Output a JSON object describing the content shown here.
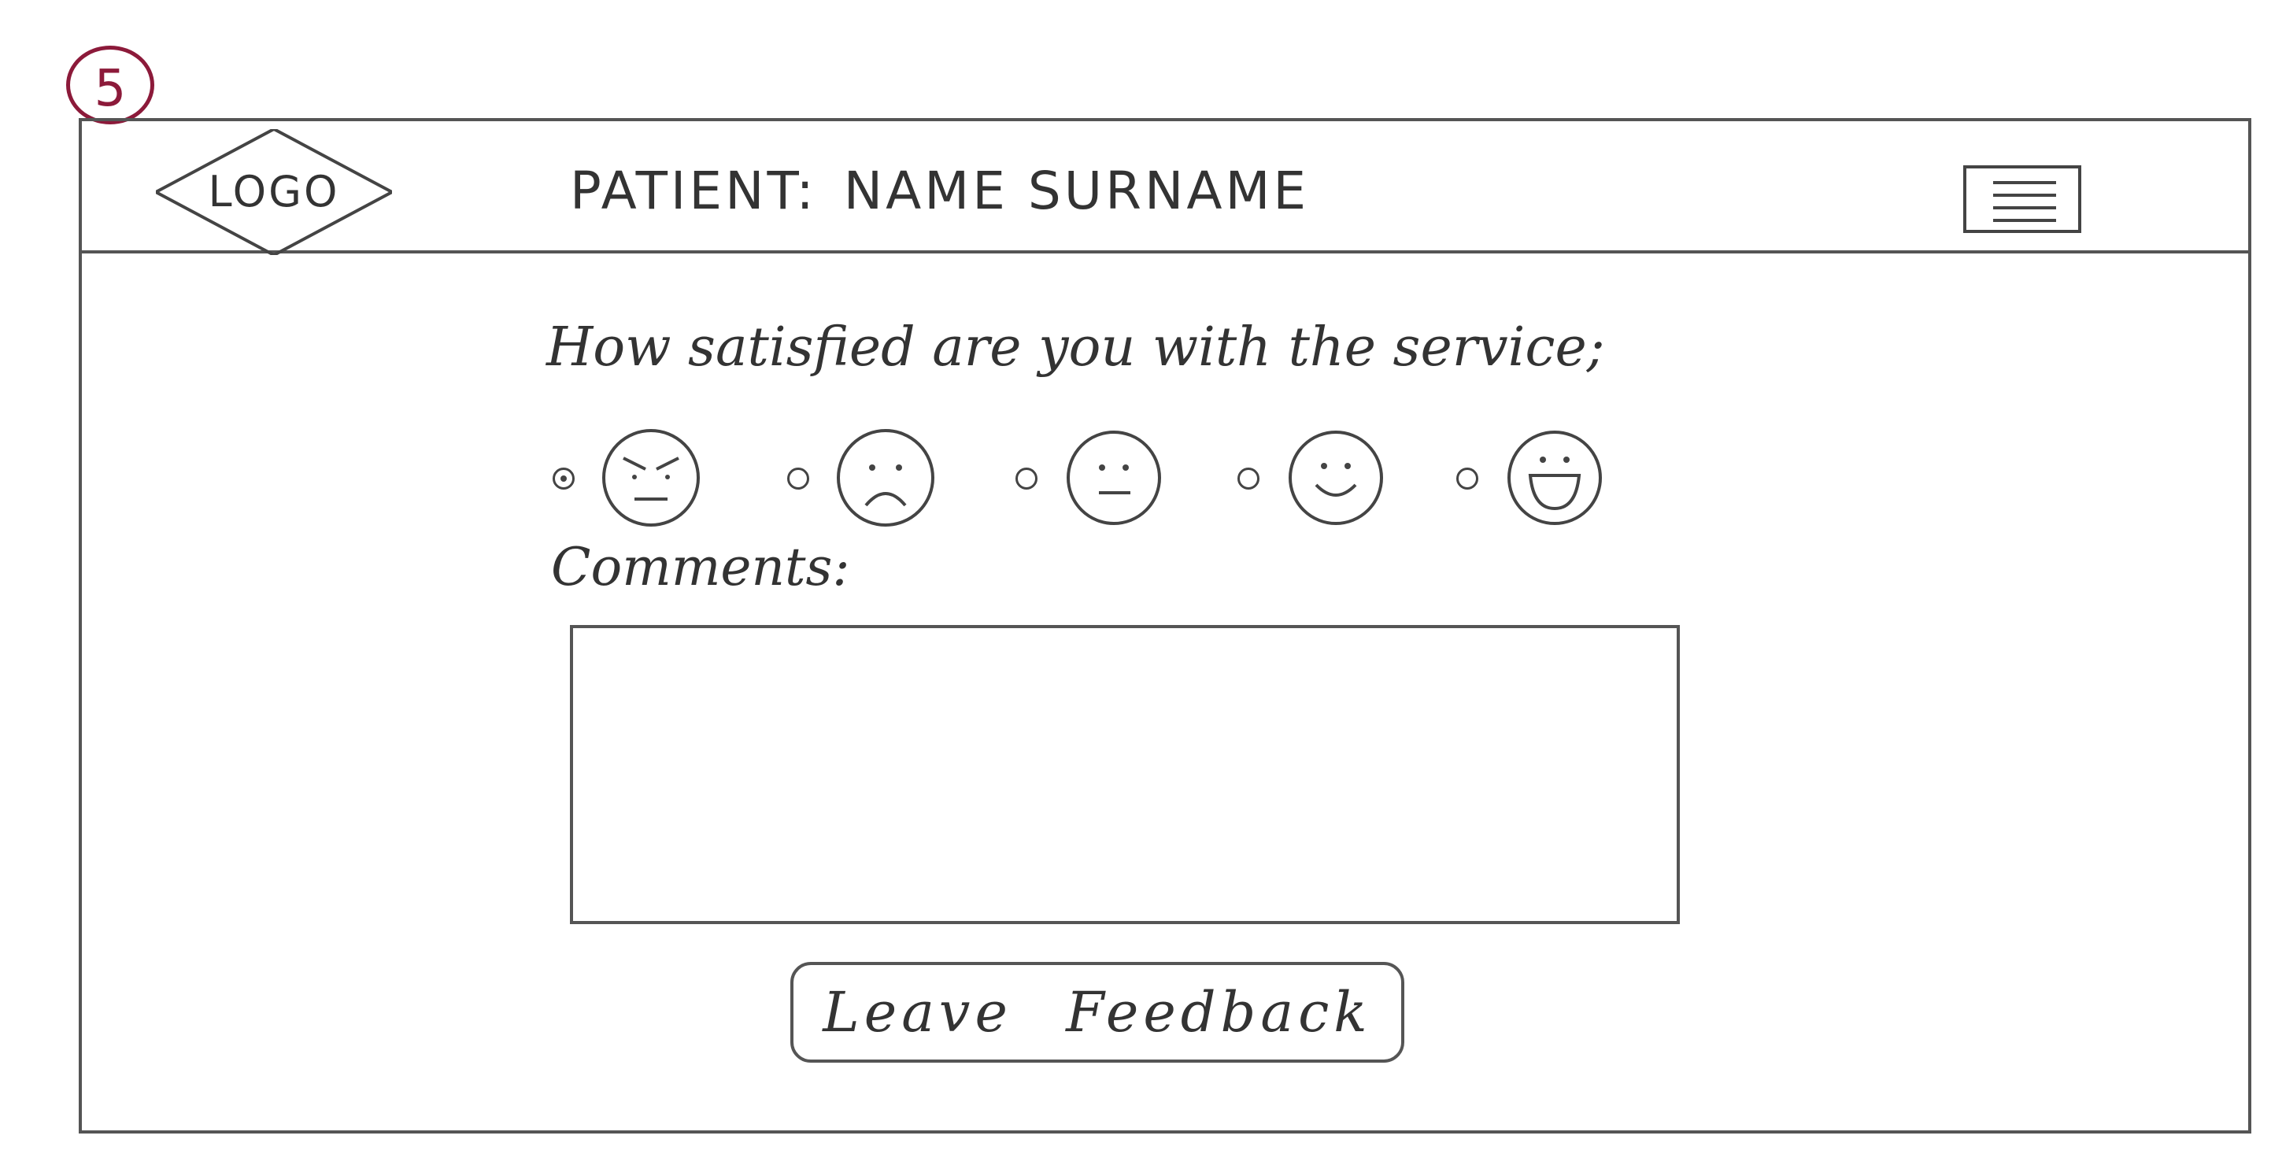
{
  "page_marker": "5",
  "header": {
    "logo_text": "LOGO",
    "patient_label": "PATIENT:",
    "patient_name": "NAME SURNAME",
    "menu_icon": "hamburger-menu-icon"
  },
  "survey": {
    "question": "How satisfied are you with the service;",
    "ratings": [
      {
        "id": "very-dissatisfied",
        "icon": "angry-face-icon",
        "selected": true
      },
      {
        "id": "dissatisfied",
        "icon": "sad-face-icon",
        "selected": false
      },
      {
        "id": "neutral",
        "icon": "neutral-face-icon",
        "selected": false
      },
      {
        "id": "satisfied",
        "icon": "smiling-face-icon",
        "selected": false
      },
      {
        "id": "very-satisfied",
        "icon": "grinning-face-icon",
        "selected": false
      }
    ],
    "comments_label": "Comments:",
    "comments_value": "",
    "submit_label": "Leave Feedback"
  },
  "colors": {
    "page_marker": "#8c1a3a",
    "ink": "#3a3a3a"
  }
}
